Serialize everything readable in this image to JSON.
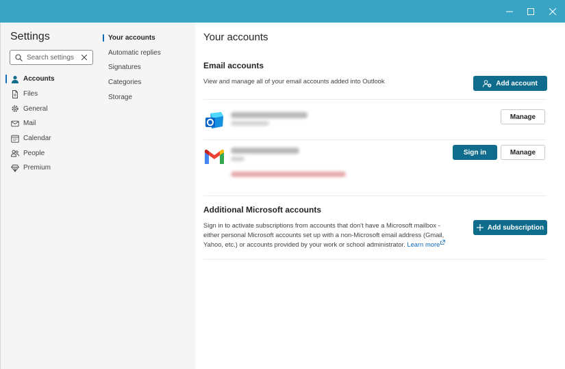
{
  "window": {
    "controls": {
      "minimize": "minimize-icon",
      "maximize": "maximize-icon",
      "close": "close-icon"
    }
  },
  "sidebar": {
    "title": "Settings",
    "search": {
      "placeholder": "Search settings",
      "value": ""
    },
    "items": [
      {
        "label": "Accounts",
        "icon": "person-icon",
        "active": true
      },
      {
        "label": "Files",
        "icon": "file-icon",
        "active": false
      },
      {
        "label": "General",
        "icon": "gear-icon",
        "active": false
      },
      {
        "label": "Mail",
        "icon": "mail-icon",
        "active": false
      },
      {
        "label": "Calendar",
        "icon": "calendar-icon",
        "active": false
      },
      {
        "label": "People",
        "icon": "people-icon",
        "active": false
      },
      {
        "label": "Premium",
        "icon": "diamond-icon",
        "active": false
      }
    ]
  },
  "subnav": {
    "items": [
      {
        "label": "Your accounts",
        "active": true
      },
      {
        "label": "Automatic replies",
        "active": false
      },
      {
        "label": "Signatures",
        "active": false
      },
      {
        "label": "Categories",
        "active": false
      },
      {
        "label": "Storage",
        "active": false
      }
    ]
  },
  "main": {
    "title": "Your accounts",
    "email_accounts": {
      "heading": "Email accounts",
      "description": "View and manage all of your email accounts added into Outlook",
      "add_button": "Add account",
      "accounts": [
        {
          "provider_icon": "outlook-icon",
          "manage_label": "Manage",
          "sign_in_label": null
        },
        {
          "provider_icon": "gmail-icon",
          "manage_label": "Manage",
          "sign_in_label": "Sign in"
        }
      ]
    },
    "additional": {
      "heading": "Additional Microsoft accounts",
      "description": "Sign in to activate subscriptions from accounts that don't have a Microsoft mailbox - either personal Microsoft accounts set up with a non-Microsoft email address (Gmail, Yahoo, etc.) or accounts provided by your work or school administrator.",
      "learn_more": "Learn more",
      "add_button": "Add subscription"
    }
  },
  "colors": {
    "titlebar": "#3aa4c4",
    "primary_button": "#0f6c8c",
    "accent": "#0f6cbd",
    "error_text": "#d13438"
  }
}
